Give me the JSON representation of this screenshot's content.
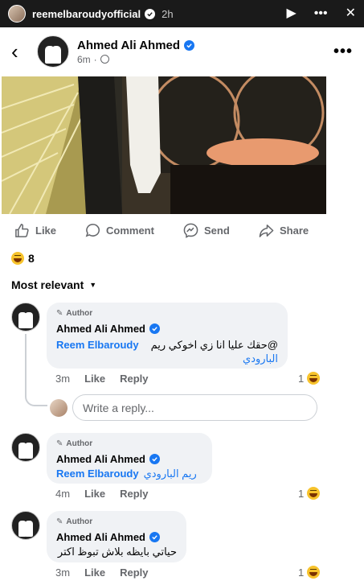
{
  "story": {
    "username": "reemelbaroudyofficial",
    "time": "2h",
    "icons": [
      "play-icon",
      "more-icon",
      "close-icon"
    ]
  },
  "post": {
    "author": "Ahmed Ali Ahmed",
    "time": "6m",
    "audience_icon": "globe-icon"
  },
  "actions": [
    {
      "label": "Like",
      "icon": "like-icon"
    },
    {
      "label": "Comment",
      "icon": "comment-icon"
    },
    {
      "label": "Send",
      "icon": "messenger-icon"
    },
    {
      "label": "Share",
      "icon": "share-icon"
    }
  ],
  "reactions": {
    "count": "8",
    "icon": "haha-icon"
  },
  "sort_label": "Most relevant",
  "comments": [
    {
      "tag": "Author",
      "name": "Ahmed Ali Ahmed",
      "mention": "Reem Elbaroudy",
      "text_line1": "@حقك عليا انا زي اخوكي ريم",
      "text_line2": "البارودي",
      "time": "3m",
      "like": "Like",
      "reply": "Reply",
      "reaction_count": "1"
    },
    {
      "tag": "Author",
      "name": "Ahmed Ali Ahmed",
      "mention": "Reem Elbaroudy",
      "text_ar": "ريم البارودي",
      "time": "4m",
      "like": "Like",
      "reply": "Reply",
      "reaction_count": "1"
    },
    {
      "tag": "Author",
      "name": "Ahmed Ali Ahmed",
      "text": "حياتي بايظه بلاش تبوظ اكتر",
      "time": "3m",
      "like": "Like",
      "reply": "Reply",
      "reaction_count": "1"
    }
  ],
  "reply_box": {
    "placeholder": "Write a reply..."
  },
  "colors": {
    "accent": "#1877f2",
    "muted": "#65676b",
    "bubble": "#f0f2f5"
  }
}
